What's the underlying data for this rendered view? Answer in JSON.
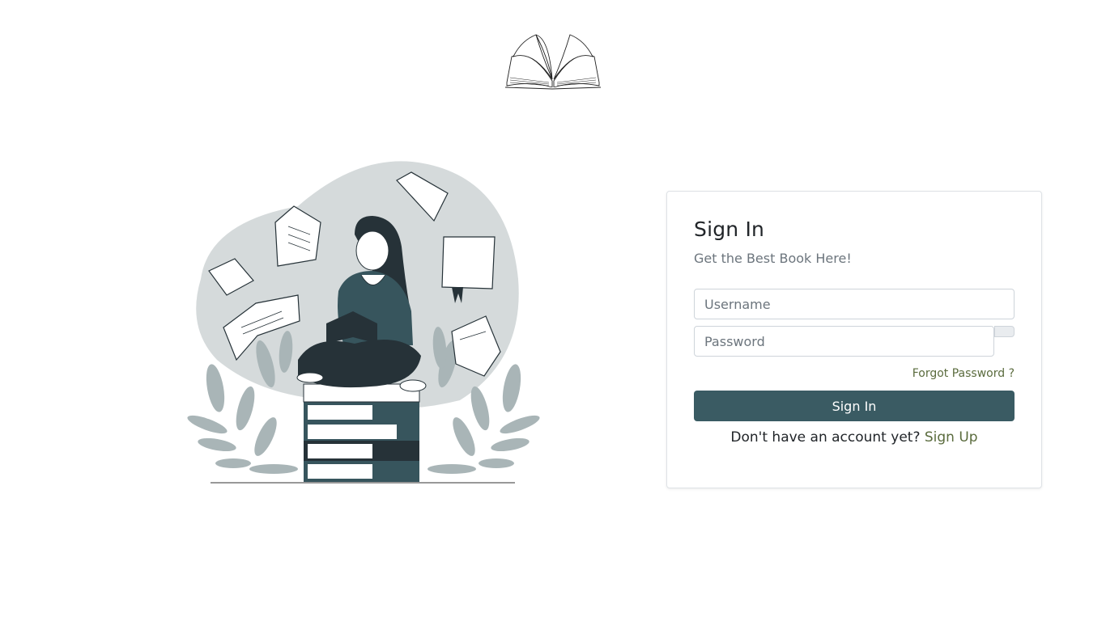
{
  "logo": {
    "icon": "open-book-icon"
  },
  "illustration": {
    "icon": "woman-reading-on-books-illustration"
  },
  "signin": {
    "title": "Sign In",
    "subtitle": "Get the Best Book Here!",
    "username_placeholder": "Username",
    "password_placeholder": "Password",
    "forgot_label": "Forgot Password ?",
    "button_label": "Sign In",
    "signup_prompt": "Don't have an account yet?",
    "signup_link": "Sign Up"
  },
  "colors": {
    "primary": "#3a5b63",
    "link": "#5a6b3d",
    "blob": "#d5dadb",
    "leaf": "#a9b5b7",
    "dark": "#263238",
    "teal": "#37555d"
  }
}
